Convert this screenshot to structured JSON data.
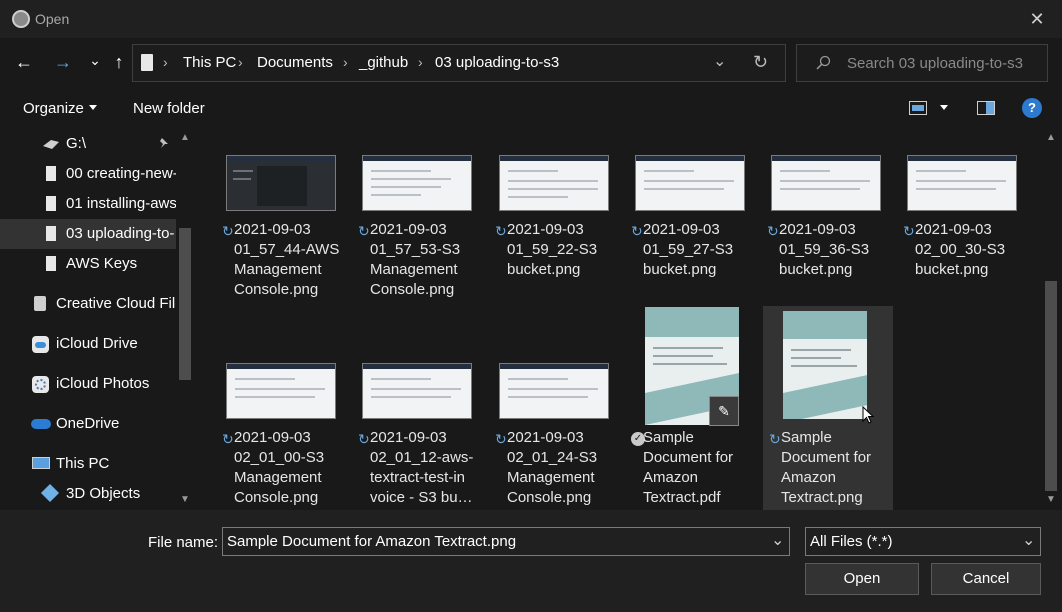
{
  "window": {
    "title": "Open",
    "close_glyph": "✕"
  },
  "nav": {
    "back_glyph": "←",
    "forward_glyph": "→",
    "recent_glyph": "⌄",
    "up_glyph": "↑",
    "breadcrumbs": [
      "This PC",
      "Documents",
      "_github",
      "03 uploading-to-s3"
    ],
    "separator": "›",
    "dropdown_glyph": "⌄",
    "refresh_glyph": "↻",
    "search_placeholder": "Search 03 uploading-to-s3"
  },
  "toolbar": {
    "organize_label": "Organize",
    "new_folder_label": "New folder",
    "help_glyph": "?"
  },
  "sidebar": {
    "items": [
      {
        "label": "G:\\",
        "icon": "drive-icon",
        "pinned": true
      },
      {
        "label": "00 creating-new-",
        "icon": "folder-icon"
      },
      {
        "label": "01 installing-aws",
        "icon": "folder-icon"
      },
      {
        "label": "03 uploading-to-",
        "icon": "folder-icon",
        "selected": true
      },
      {
        "label": "AWS Keys",
        "icon": "folder-icon"
      },
      {
        "label": "Creative Cloud File",
        "icon": "creative-cloud-icon"
      },
      {
        "label": "iCloud Drive",
        "icon": "icloud-drive-icon"
      },
      {
        "label": "iCloud Photos",
        "icon": "icloud-photos-icon"
      },
      {
        "label": "OneDrive",
        "icon": "onedrive-icon"
      },
      {
        "label": "This PC",
        "icon": "this-pc-icon"
      },
      {
        "label": "3D Objects",
        "icon": "3d-objects-icon"
      }
    ]
  },
  "files": [
    {
      "label": "2021-09-03\n01_57_44-AWS\nManagement\nConsole.png",
      "status": "sync"
    },
    {
      "label": "2021-09-03\n01_57_53-S3\nManagement\nConsole.png",
      "status": "sync"
    },
    {
      "label": "2021-09-03\n01_59_22-S3\nbucket.png",
      "status": "sync"
    },
    {
      "label": "2021-09-03\n01_59_27-S3\nbucket.png",
      "status": "sync"
    },
    {
      "label": "2021-09-03\n01_59_36-S3\nbucket.png",
      "status": "sync"
    },
    {
      "label": "2021-09-03\n02_00_30-S3\nbucket.png",
      "status": "sync"
    },
    {
      "label": "2021-09-03\n02_01_00-S3\nManagement\nConsole.png",
      "status": "sync"
    },
    {
      "label": "2021-09-03\n02_01_12-aws-\ntextract-test-in\nvoice - S3 bu…",
      "status": "sync"
    },
    {
      "label": "2021-09-03\n02_01_24-S3\nManagement\nConsole.png",
      "status": "sync"
    },
    {
      "label": "Sample\nDocument for\nAmazon\nTextract.pdf",
      "status": "available"
    },
    {
      "label": "Sample\nDocument for\nAmazon\nTextract.png",
      "status": "sync",
      "selected": true
    }
  ],
  "bottom": {
    "file_name_label": "File name:",
    "file_name_value": "Sample Document for Amazon Textract.png",
    "filter_value": "All Files (*.*)",
    "open_label": "Open",
    "cancel_label": "Cancel"
  },
  "colors": {
    "accent_sync": "#6aa7de",
    "selection": "#333333",
    "background": "#191919"
  }
}
